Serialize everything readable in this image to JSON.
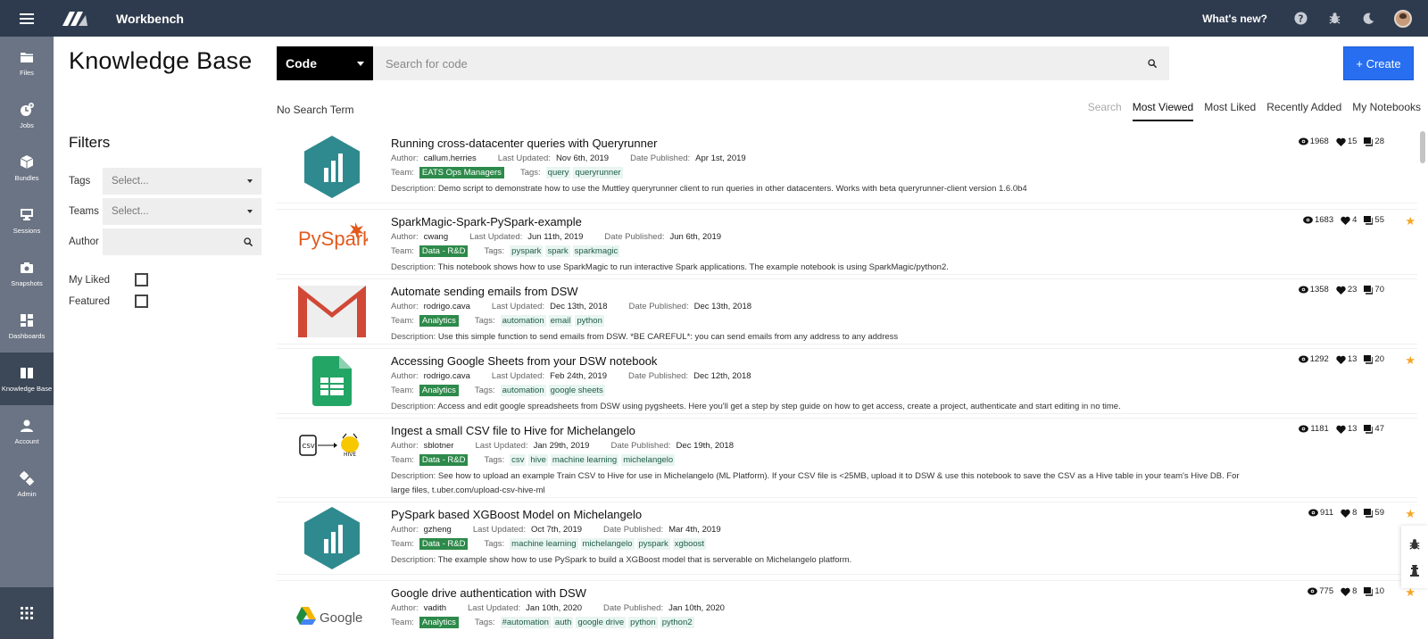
{
  "app": {
    "title": "Workbench",
    "whats_new": "What's new?"
  },
  "sidebar": {
    "items": [
      {
        "label": "Files",
        "icon": "folder-icon"
      },
      {
        "label": "Jobs",
        "icon": "jobs-icon"
      },
      {
        "label": "Bundles",
        "icon": "bundle-icon"
      },
      {
        "label": "Sessions",
        "icon": "monitor-icon"
      },
      {
        "label": "Snapshots",
        "icon": "camera-icon"
      },
      {
        "label": "Dashboards",
        "icon": "dashboard-icon"
      },
      {
        "label": "Knowledge Base",
        "icon": "book-icon",
        "active": true
      },
      {
        "label": "Account",
        "icon": "user-icon"
      },
      {
        "label": "Admin",
        "icon": "gears-icon"
      }
    ]
  },
  "page": {
    "title": "Knowledge Base"
  },
  "filters": {
    "title": "Filters",
    "tags_label": "Tags",
    "tags_placeholder": "Select...",
    "teams_label": "Teams",
    "teams_placeholder": "Select...",
    "author_label": "Author",
    "my_liked_label": "My Liked",
    "featured_label": "Featured"
  },
  "search": {
    "type_value": "Code",
    "placeholder": "Search for code",
    "create_label": "+ Create",
    "no_term": "No Search Term"
  },
  "sort_tabs": [
    {
      "label": "Search",
      "state": "disabled"
    },
    {
      "label": "Most Viewed",
      "state": "active"
    },
    {
      "label": "Most Liked",
      "state": ""
    },
    {
      "label": "Recently Added",
      "state": ""
    },
    {
      "label": "My Notebooks",
      "state": ""
    }
  ],
  "labels": {
    "author": "Author:",
    "last_updated": "Last Updated:",
    "date_published": "Date Published:",
    "team": "Team:",
    "tags": "Tags:",
    "description": "Description:"
  },
  "notebooks": [
    {
      "title": "Running cross-datacenter queries with Queryrunner",
      "author": "callum.herries",
      "last_updated": "Nov 6th, 2019",
      "date_published": "Apr 1st, 2019",
      "team": "EATS Ops Managers",
      "tags": [
        "query",
        "queryrunner"
      ],
      "description": "Demo script to demonstrate how to use the Muttley queryrunner client to run queries in other datacenters. Works with beta queryrunner-client version 1.6.0b4",
      "views": "1968",
      "likes": "15",
      "comments": "28",
      "starred": false,
      "thumb": "hex-chart-logo"
    },
    {
      "title": "SparkMagic-Spark-PySpark-example",
      "author": "cwang",
      "last_updated": "Jun 11th, 2019",
      "date_published": "Jun 6th, 2019",
      "team": "Data - R&D",
      "tags": [
        "pyspark",
        "spark",
        "sparkmagic"
      ],
      "description": "This notebook shows how to use SparkMagic to run interactive Spark applications. The example notebook is using SparkMagic/python2.",
      "views": "1683",
      "likes": "4",
      "comments": "55",
      "starred": true,
      "thumb": "pyspark-logo",
      "thumb_text": "PySpark"
    },
    {
      "title": "Automate sending emails from DSW",
      "author": "rodrigo.cava",
      "last_updated": "Dec 13th, 2018",
      "date_published": "Dec 13th, 2018",
      "team": "Analytics",
      "tags": [
        "automation",
        "email",
        "python"
      ],
      "description": "Use this simple function to send emails from DSW. *BE CAREFUL*: you can send emails from any address to any address",
      "views": "1358",
      "likes": "23",
      "comments": "70",
      "starred": false,
      "thumb": "gmail-logo"
    },
    {
      "title": "Accessing Google Sheets from your DSW notebook",
      "author": "rodrigo.cava",
      "last_updated": "Feb 24th, 2019",
      "date_published": "Dec 12th, 2018",
      "team": "Analytics",
      "tags": [
        "automation",
        "google sheets"
      ],
      "description": "Access and edit google spreadsheets from DSW using pygsheets. Here you'll get a step by step guide on how to get access, create a project, authenticate and start editing in no time.",
      "views": "1292",
      "likes": "13",
      "comments": "20",
      "starred": true,
      "thumb": "google-sheets-logo"
    },
    {
      "title": "Ingest a small CSV file to Hive for Michelangelo",
      "author": "sblotner",
      "last_updated": "Jan 29th, 2019",
      "date_published": "Dec 19th, 2018",
      "team": "Data - R&D",
      "tags": [
        "csv",
        "hive",
        "machine learning",
        "michelangelo"
      ],
      "description": "See how to upload an example Train CSV to Hive for use in Michelangelo (ML Platform). If your CSV file is <25MB, upload it to DSW & use this notebook to save the CSV as a Hive table in your team's Hive DB. For large files, t.uber.com/upload-csv-hive-ml",
      "views": "1181",
      "likes": "13",
      "comments": "47",
      "starred": false,
      "thumb": "csv-to-hive-logo",
      "thumb_text": "CSV",
      "thumb_text2": "HIVE"
    },
    {
      "title": "PySpark based XGBoost Model on Michelangelo",
      "author": "gzheng",
      "last_updated": "Oct 7th, 2019",
      "date_published": "Mar 4th, 2019",
      "team": "Data - R&D",
      "tags": [
        "machine learning",
        "michelangelo",
        "pyspark",
        "xgboost"
      ],
      "description": "The example show how to use PySpark to build a XGBoost model that is serverable on Michelangelo platform.",
      "views": "911",
      "likes": "8",
      "comments": "59",
      "starred": true,
      "thumb": "hex-chart-logo"
    },
    {
      "title": "Google drive authentication with DSW",
      "author": "vadith",
      "last_updated": "Jan 10th, 2020",
      "date_published": "Jan 10th, 2020",
      "team": "Analytics",
      "tags": [
        "#automation",
        "auth",
        "google drive",
        "python",
        "python2"
      ],
      "description": "",
      "views": "775",
      "likes": "8",
      "comments": "10",
      "starred": true,
      "thumb": "google-drive-logo",
      "thumb_text": "Google"
    }
  ],
  "colors": {
    "topbar": "#2e3b4e",
    "sidebar": "#6b7484",
    "sidebar_active": "#3c4757",
    "accent": "#276ef1",
    "team_badge": "#2d8a4a",
    "tag_bg": "#e8f5f1",
    "star": "#f5a623"
  }
}
